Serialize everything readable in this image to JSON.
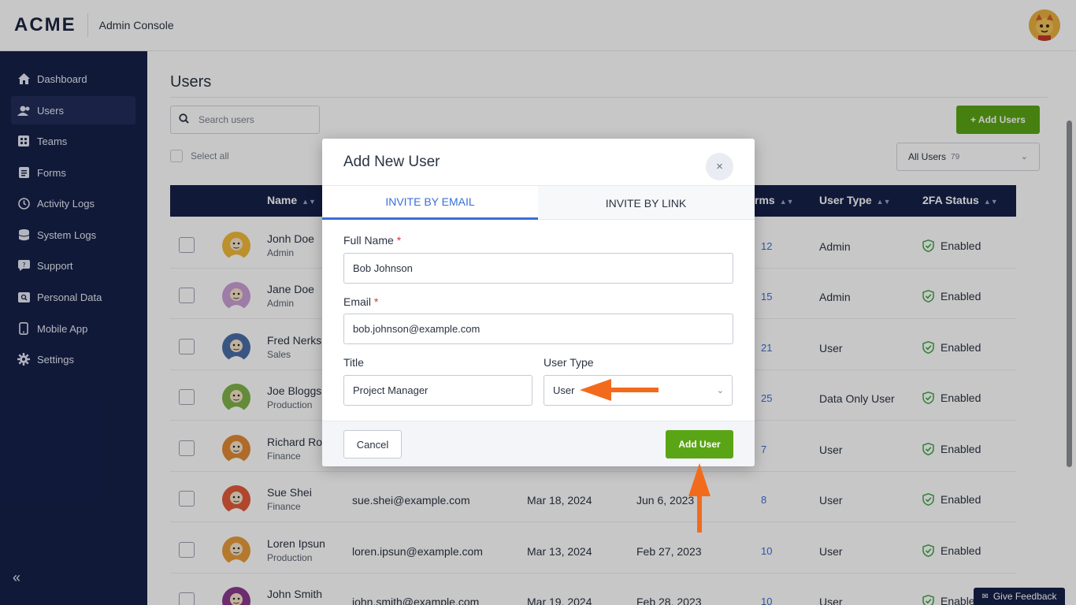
{
  "header": {
    "logo": "ACME",
    "title": "Admin Console",
    "avatar_icon": "user-avatar"
  },
  "sidebar": {
    "items": [
      {
        "label": "Dashboard",
        "icon": "home-icon"
      },
      {
        "label": "Users",
        "icon": "users-icon",
        "active": true
      },
      {
        "label": "Teams",
        "icon": "teams-icon"
      },
      {
        "label": "Forms",
        "icon": "forms-icon"
      },
      {
        "label": "Activity Logs",
        "icon": "clock-icon"
      },
      {
        "label": "System Logs",
        "icon": "database-icon"
      },
      {
        "label": "Support",
        "icon": "support-icon"
      },
      {
        "label": "Personal Data",
        "icon": "personal-data-icon"
      },
      {
        "label": "Mobile App",
        "icon": "mobile-icon"
      },
      {
        "label": "Settings",
        "icon": "gear-icon"
      }
    ],
    "collapse": "«"
  },
  "main": {
    "title": "Users",
    "search_placeholder": "Search users",
    "add_users_label": "+ Add Users",
    "select_all": "Select all",
    "filter": {
      "label": "All Users",
      "count": "79"
    }
  },
  "table": {
    "headers": {
      "name": "Name",
      "forms": "rms",
      "user_type": "User Type",
      "twofa": "2FA Status"
    },
    "rows": [
      {
        "name": "Jonh Doe",
        "dept": "Admin",
        "email": "",
        "d1": "",
        "d2": "",
        "forms": "12",
        "type": "Admin",
        "twofa": "Enabled"
      },
      {
        "name": "Jane Doe",
        "dept": "Admin",
        "email": "",
        "d1": "",
        "d2": "",
        "forms": "15",
        "type": "Admin",
        "twofa": "Enabled"
      },
      {
        "name": "Fred Nerks",
        "dept": "Sales",
        "email": "",
        "d1": "",
        "d2": "",
        "forms": "21",
        "type": "User",
        "twofa": "Enabled"
      },
      {
        "name": "Joe Bloggs",
        "dept": "Production",
        "email": "",
        "d1": "",
        "d2": "",
        "forms": "25",
        "type": "Data Only User",
        "twofa": "Enabled"
      },
      {
        "name": "Richard Ro",
        "dept": "Finance",
        "email": "",
        "d1": "",
        "d2": "",
        "forms": "7",
        "type": "User",
        "twofa": "Enabled"
      },
      {
        "name": "Sue Shei",
        "dept": "Finance",
        "email": "sue.shei@example.com",
        "d1": "Mar 18, 2024",
        "d2": "Jun 6, 2023",
        "forms": "8",
        "type": "User",
        "twofa": "Enabled"
      },
      {
        "name": "Loren Ipsun",
        "dept": "Production",
        "email": "loren.ipsun@example.com",
        "d1": "Mar 13, 2024",
        "d2": "Feb 27, 2023",
        "forms": "10",
        "type": "User",
        "twofa": "Enabled"
      },
      {
        "name": "John Smith",
        "dept": "",
        "email": "john.smith@example.com",
        "d1": "Mar 19, 2024",
        "d2": "Feb 28, 2023",
        "forms": "10",
        "type": "User",
        "twofa": "Enable"
      }
    ]
  },
  "modal": {
    "title": "Add New User",
    "close": "×",
    "tabs": {
      "email": "INVITE BY EMAIL",
      "link": "INVITE BY LINK"
    },
    "full_name_label": "Full Name",
    "full_name_value": "Bob Johnson",
    "email_label": "Email",
    "email_value": "bob.johnson@example.com",
    "required_mark": "*",
    "title_label": "Title",
    "title_value": "Project Manager",
    "user_type_label": "User Type",
    "user_type_value": "User",
    "cancel": "Cancel",
    "add_user": "Add User"
  },
  "feedback": "Give Feedback",
  "colors": {
    "sidebar": "#16204a",
    "accent_green": "#5aa515",
    "link_blue": "#3a6fd8",
    "annotation_orange": "#f26b1d"
  }
}
